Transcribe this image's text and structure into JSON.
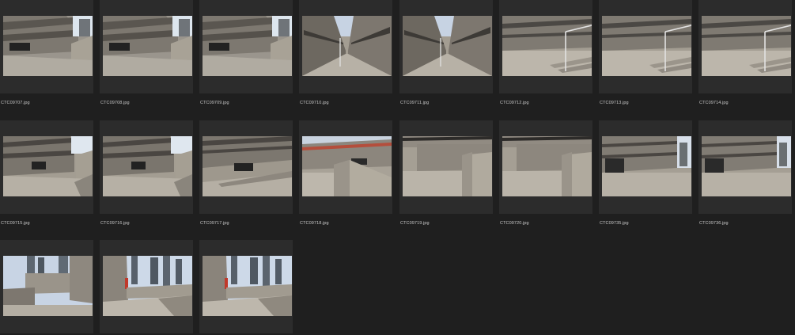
{
  "photos": [
    {
      "filename": "CTC09707.jpg",
      "scene": "walkway-wall"
    },
    {
      "filename": "CTC09708.jpg",
      "scene": "walkway-wall"
    },
    {
      "filename": "CTC09709.jpg",
      "scene": "walkway-wall"
    },
    {
      "filename": "CTC09710.jpg",
      "scene": "corridor-sky"
    },
    {
      "filename": "CTC09711.jpg",
      "scene": "corridor-sky"
    },
    {
      "filename": "CTC09712.jpg",
      "scene": "rail-steps"
    },
    {
      "filename": "CTC09713.jpg",
      "scene": "rail-steps"
    },
    {
      "filename": "CTC09714.jpg",
      "scene": "rail-steps"
    },
    {
      "filename": "CTC09715.jpg",
      "scene": "walkway-stairs"
    },
    {
      "filename": "CTC09716.jpg",
      "scene": "walkway-stairs"
    },
    {
      "filename": "CTC09717.jpg",
      "scene": "wall-ledge"
    },
    {
      "filename": "CTC09718.jpg",
      "scene": "low-wall"
    },
    {
      "filename": "CTC09719.jpg",
      "scene": "block-wall"
    },
    {
      "filename": "CTC09720.jpg",
      "scene": "block-wall"
    },
    {
      "filename": "CTC09735.jpg",
      "scene": "plaza-wall"
    },
    {
      "filename": "CTC09736.jpg",
      "scene": "plaza-wall"
    },
    {
      "filename": "",
      "scene": "city-open"
    },
    {
      "filename": "",
      "scene": "city-steps"
    },
    {
      "filename": "",
      "scene": "city-steps"
    }
  ],
  "colors": {
    "background": "#1f1f1f",
    "cell": "#2c2c2c",
    "label": "#c8c8c8",
    "concrete": "#8d8880",
    "sky": "#c9d6e6"
  }
}
